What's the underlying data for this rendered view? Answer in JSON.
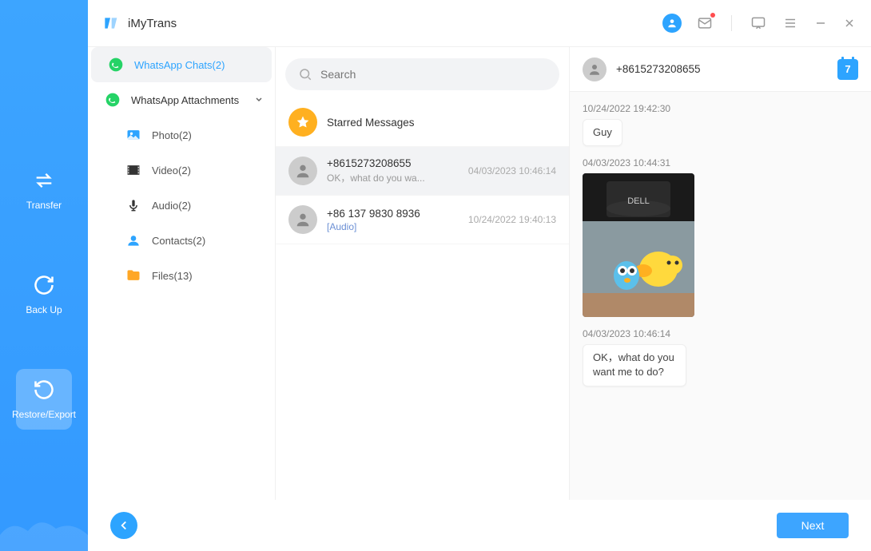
{
  "app": {
    "name": "iMyTrans"
  },
  "nav": {
    "transfer": "Transfer",
    "backup": "Back Up",
    "restore": "Restore/Export"
  },
  "categories": {
    "chats": "WhatsApp Chats(2)",
    "attachments": "WhatsApp Attachments",
    "items": [
      {
        "label": "Photo(2)"
      },
      {
        "label": "Video(2)"
      },
      {
        "label": "Audio(2)"
      },
      {
        "label": "Contacts(2)"
      },
      {
        "label": "Files(13)"
      }
    ]
  },
  "search": {
    "placeholder": "Search"
  },
  "convos": {
    "starred": "Starred Messages",
    "list": [
      {
        "title": "+8615273208655",
        "sub": "OK，what do you wa...",
        "time": "04/03/2023 10:46:14"
      },
      {
        "title": "+86 137 9830 8936",
        "sub": "[Audio]",
        "time": "10/24/2022 19:40:13"
      }
    ]
  },
  "chat": {
    "header_name": "+8615273208655",
    "calendar_day": "7",
    "messages": [
      {
        "ts": "10/24/2022 19:42:30",
        "text": "Guy"
      },
      {
        "ts": "04/03/2023 10:44:31",
        "image": true
      },
      {
        "ts": "04/03/2023 10:46:14",
        "text": "OK，what do you want me to do?"
      }
    ]
  },
  "footer": {
    "next": "Next"
  }
}
